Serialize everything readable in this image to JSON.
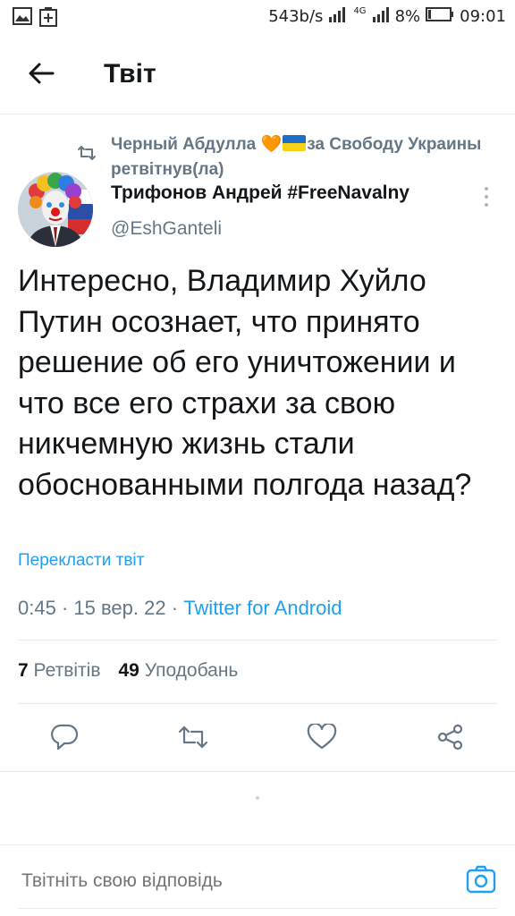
{
  "status_bar": {
    "speed": "543b/s",
    "network": "4G",
    "battery": "8%",
    "time": "09:01"
  },
  "header": {
    "title": "Твіт"
  },
  "retweet": {
    "user": "Черный Абдулла",
    "heart": "🧡",
    "suffix": "за Свободу Украины",
    "action": "ретвітнув(ла)"
  },
  "author": {
    "name": "Трифонов Андрей #FreeNavalny",
    "handle": "@EshGanteli"
  },
  "tweet": {
    "text": "Интересно, Владимир Хуйло Путин осознает, что принято решение об его уничтожении и что все его страхи за свою никчемную жизнь стали обоснованными полгода назад?",
    "translate": "Перекласти твіт",
    "time": "0:45",
    "date": "15 вер. 22",
    "source": "Twitter for Android"
  },
  "stats": {
    "retweets_count": "7",
    "retweets_label": "Ретвітів",
    "likes_count": "49",
    "likes_label": "Уподобань"
  },
  "reply": {
    "placeholder": "Твітніть свою відповідь"
  },
  "colors": {
    "accent": "#1da1f2",
    "muted": "#657786",
    "text": "#14171a",
    "divider": "#e6ecf0"
  }
}
